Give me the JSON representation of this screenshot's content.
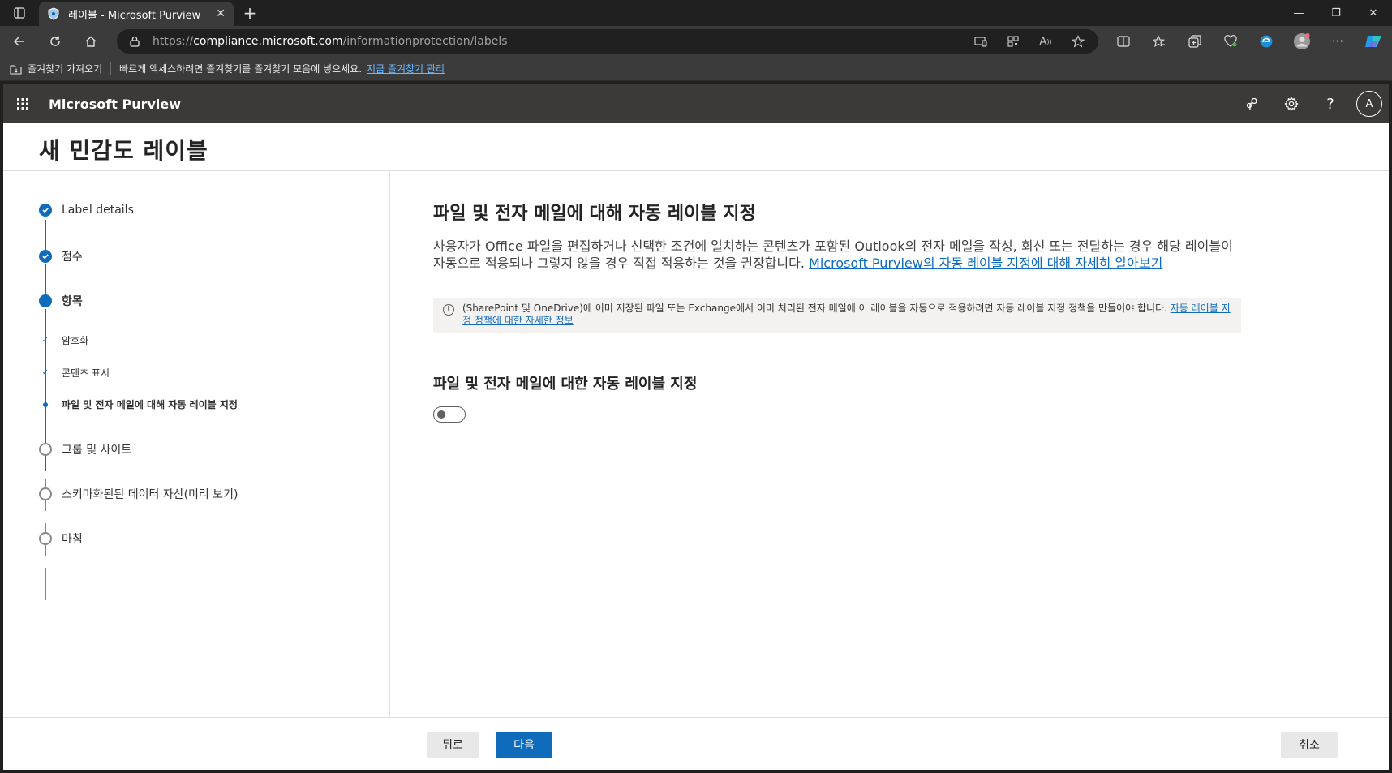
{
  "browser": {
    "tab_title": "레이블 - Microsoft Purview",
    "url_prefix": "https://",
    "url_host": "compliance.microsoft.com",
    "url_path": "/informationprotection/labels",
    "favorites_import": "즐겨찾기 가져오기",
    "favorites_hint": "빠르게 액세스하려면 즐겨찾기를 즐겨찾기 모음에 넣으세요.",
    "favorites_manage": "지금 즐겨찾기 관리"
  },
  "suite": {
    "brand": "Microsoft Purview",
    "avatar_initial": "A",
    "help_label": "?"
  },
  "page": {
    "title": "새 민감도 레이블"
  },
  "steps": [
    {
      "label": "Label details",
      "state": "done"
    },
    {
      "label": "점수",
      "state": "done"
    },
    {
      "label": "항목",
      "state": "current"
    },
    {
      "label": "암호화",
      "state": "sub-done"
    },
    {
      "label": "콘텐츠 표시",
      "state": "sub-done"
    },
    {
      "label": "파일 및 전자 메일에 대해 자동 레이블 지정",
      "state": "sub-current"
    },
    {
      "label": "그룹 및 사이트",
      "state": "todo"
    },
    {
      "label": "스키마화된된 데이터 자산(미리 보기)",
      "state": "todo"
    },
    {
      "label": "마침",
      "state": "todo"
    }
  ],
  "main": {
    "heading": "파일 및 전자 메일에 대해 자동 레이블 지정",
    "description": "사용자가 Office 파일을 편집하거나 선택한 조건에 일치하는 콘텐츠가 포함된 Outlook의 전자 메일을 작성, 회신 또는 전달하는 경우 해당 레이블이 자동으로 적용되나 그렇지 않을 경우 직접 적용하는 것을 권장합니다. ",
    "description_link": "Microsoft Purview의 자동 레이블 지정에 대해 자세히 알아보기",
    "info_text": "(SharePoint 및 OneDrive)에 이미 저장된 파일 또는 Exchange에서 이미 처리된 전자 메일에 이 레이블을 자동으로 적용하려면 자동 레이블 지정 정책을 만들어야 합니다. ",
    "info_link": "자동 레이블 지정 정책에 대한 자세한 정보",
    "section_heading": "파일 및 전자 메일에 대한 자동 레이블 지정",
    "toggle_on": false
  },
  "footer": {
    "back": "뒤로",
    "next": "다음",
    "cancel": "취소"
  },
  "colors": {
    "accent": "#0f6cbd",
    "suitebar": "#3b3a39"
  }
}
